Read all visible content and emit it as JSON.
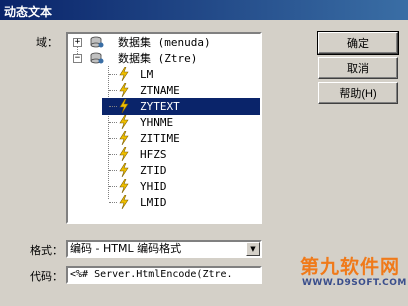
{
  "window": {
    "title": "动态文本"
  },
  "labels": {
    "domain": "域：",
    "format": "格式：",
    "code": "代码："
  },
  "tree": {
    "groups": [
      {
        "expander": "+",
        "label": "数据集 (menuda)"
      },
      {
        "expander": "−",
        "label": "数据集 (Ztre)"
      }
    ],
    "fields": [
      "LM",
      "ZTNAME",
      "ZYTEXT",
      "YHNME",
      "ZITIME",
      "HFZS",
      "ZTID",
      "YHID",
      "LMID"
    ],
    "selected_index": 2
  },
  "buttons": {
    "ok": "确定",
    "cancel": "取消",
    "help": "帮助(H)"
  },
  "format": {
    "value": "编码 - HTML 编码格式"
  },
  "code": {
    "value": "<%# Server.HtmlEncode(Ztre."
  },
  "watermark": {
    "line1": "第九软件网",
    "line2": "WWW.D9SOFT.COM"
  },
  "colors": {
    "title_bar": "#0a246a",
    "selection": "#0a246a",
    "field_icon": "#f0c000",
    "dialog_bg": "#d4d0c8"
  }
}
